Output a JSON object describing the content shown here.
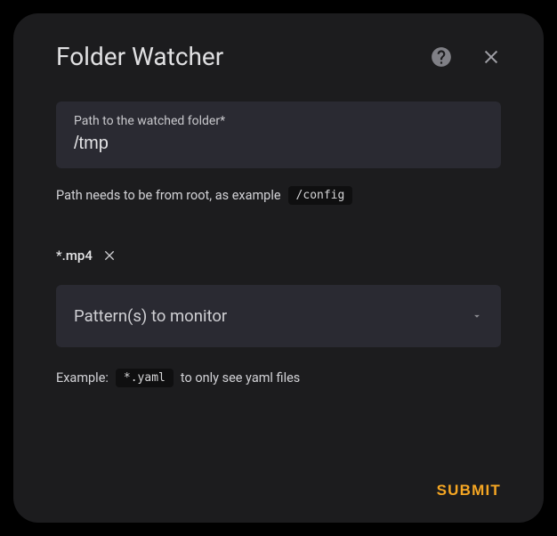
{
  "dialog": {
    "title": "Folder Watcher"
  },
  "path_field": {
    "label": "Path to the watched folder*",
    "value": "/tmp"
  },
  "path_hint": {
    "prefix": "Path needs to be from root, as example",
    "code": "/config"
  },
  "chips": [
    {
      "text": "*.mp4"
    }
  ],
  "pattern_select": {
    "label": "Pattern(s) to monitor"
  },
  "example_hint": {
    "prefix": "Example:",
    "code": "*.yaml",
    "suffix": "to only see yaml files"
  },
  "submit": {
    "label": "SUBMIT"
  }
}
